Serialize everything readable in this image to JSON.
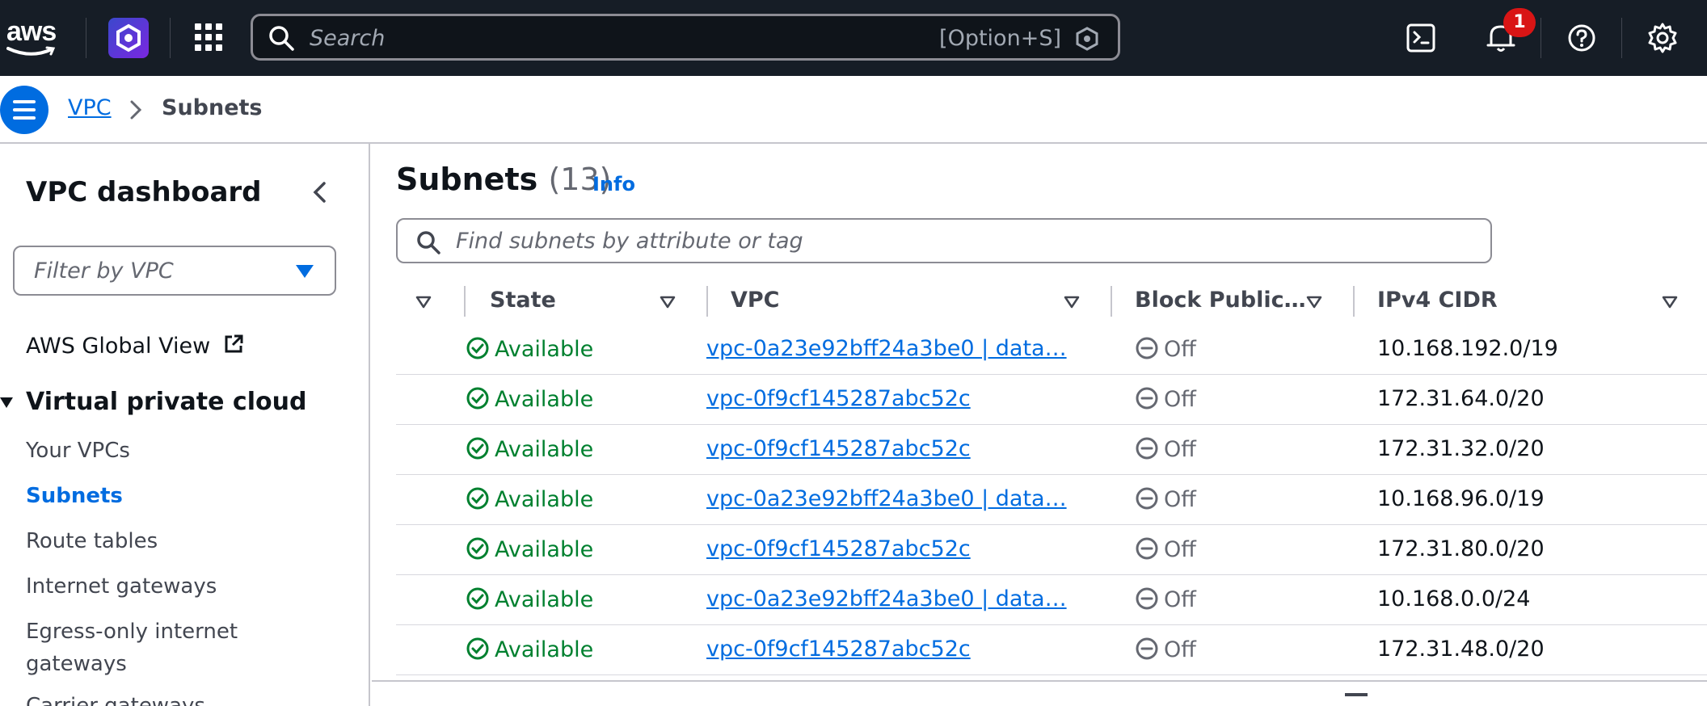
{
  "topnav": {
    "logo_text": "aws",
    "search_placeholder": "Search",
    "search_shortcut": "[Option+S]",
    "notification_count": "1"
  },
  "breadcrumb": {
    "root": "VPC",
    "current": "Subnets"
  },
  "sidebar": {
    "title": "VPC dashboard",
    "filter_placeholder": "Filter by VPC",
    "global_view": "AWS Global View",
    "section": "Virtual private cloud",
    "items": [
      "Your VPCs",
      "Subnets",
      "Route tables",
      "Internet gateways",
      "Egress-only internet gateways",
      "Carrier gateways"
    ],
    "active_item": "Subnets"
  },
  "main": {
    "title": "Subnets",
    "count": "(13)",
    "info": "Info",
    "filter_placeholder": "Find subnets by attribute or tag",
    "columns": [
      "State",
      "VPC",
      "Block Public…",
      "IPv4 CIDR"
    ],
    "rows": [
      {
        "state": "Available",
        "vpc": "vpc-0a23e92bff24a3be0 | data…",
        "block": "Off",
        "cidr": "10.168.192.0/19"
      },
      {
        "state": "Available",
        "vpc": "vpc-0f9cf145287abc52c",
        "block": "Off",
        "cidr": "172.31.64.0/20"
      },
      {
        "state": "Available",
        "vpc": "vpc-0f9cf145287abc52c",
        "block": "Off",
        "cidr": "172.31.32.0/20"
      },
      {
        "state": "Available",
        "vpc": "vpc-0a23e92bff24a3be0 | data…",
        "block": "Off",
        "cidr": "10.168.96.0/19"
      },
      {
        "state": "Available",
        "vpc": "vpc-0f9cf145287abc52c",
        "block": "Off",
        "cidr": "172.31.80.0/20"
      },
      {
        "state": "Available",
        "vpc": "vpc-0a23e92bff24a3be0 | data…",
        "block": "Off",
        "cidr": "10.168.0.0/24"
      },
      {
        "state": "Available",
        "vpc": "vpc-0f9cf145287abc52c",
        "block": "Off",
        "cidr": "172.31.48.0/20"
      }
    ]
  },
  "colors": {
    "nav_bg": "#161d26",
    "link": "#006ce0",
    "success": "#00802f",
    "badge": "#d91515"
  }
}
